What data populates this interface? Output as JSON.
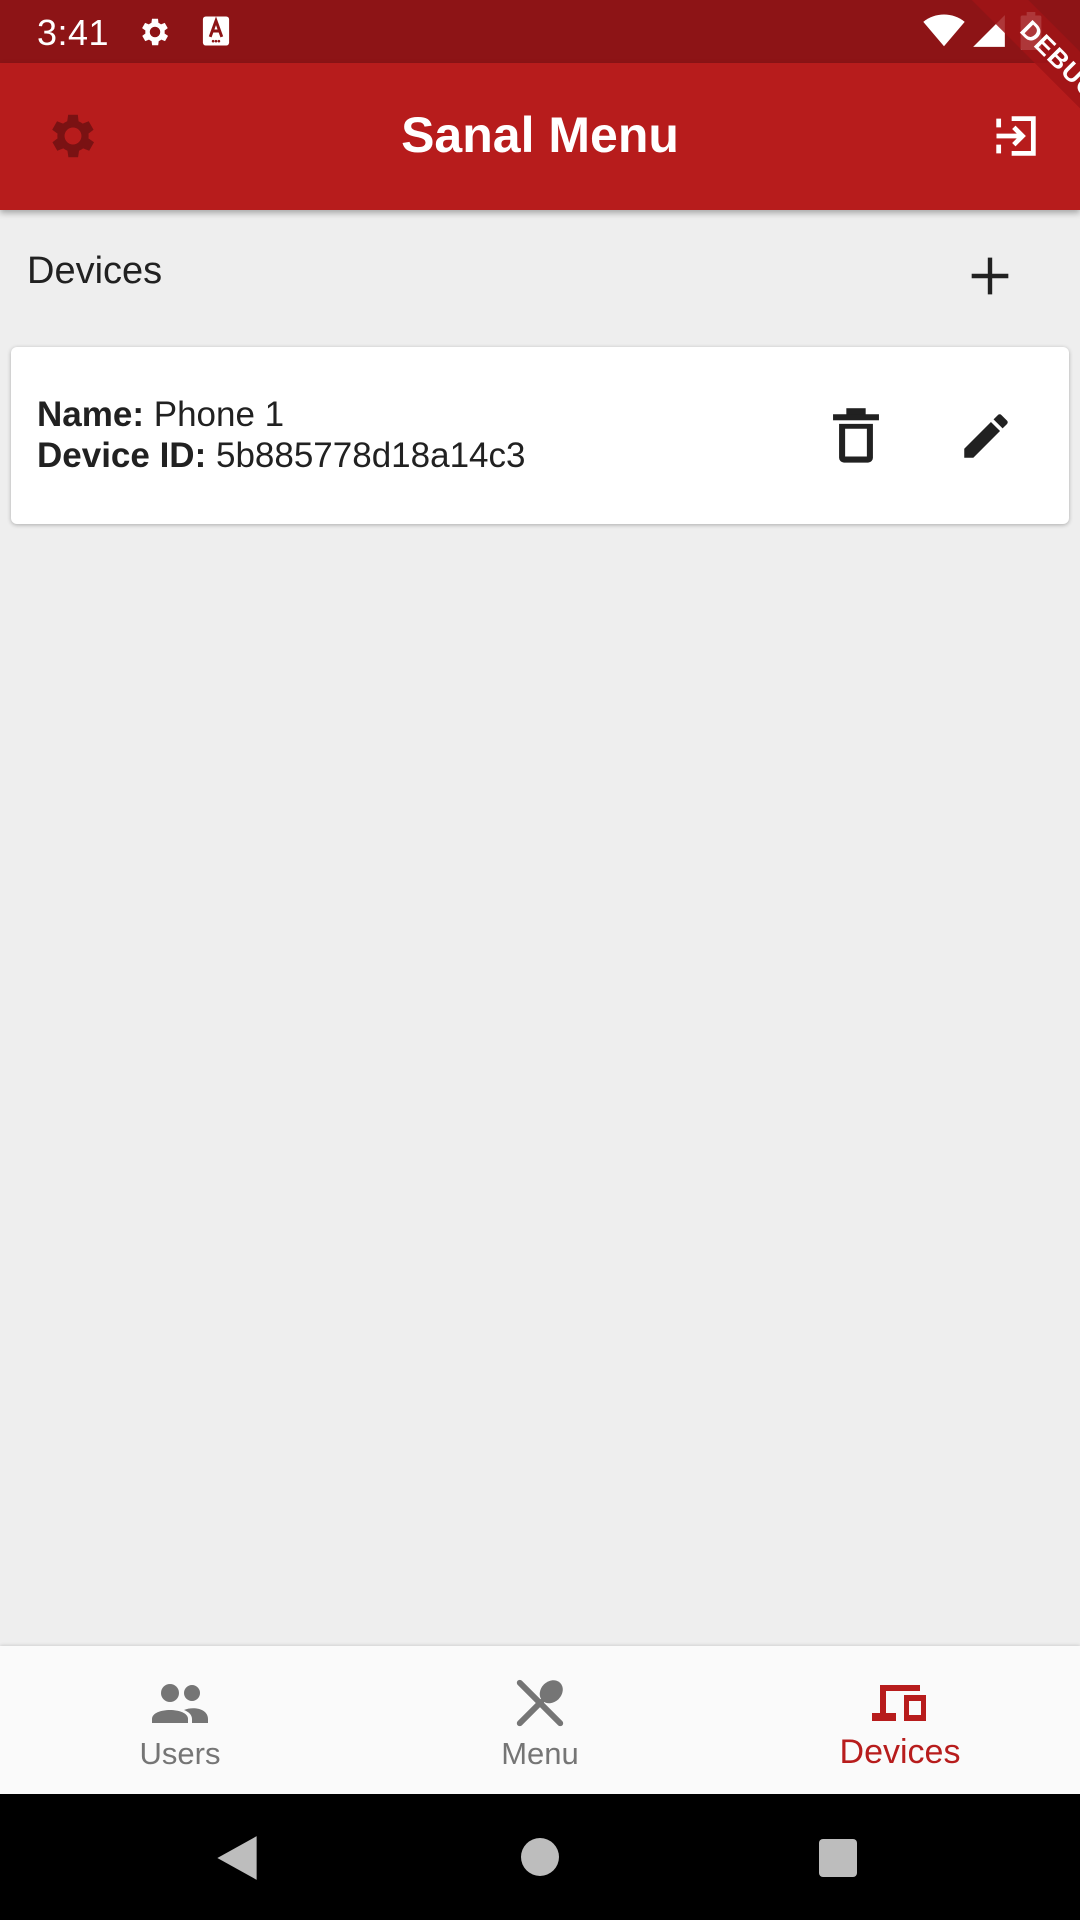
{
  "status_bar": {
    "time": "3:41",
    "icons": [
      "gear-icon",
      "a-icon",
      "wifi-icon",
      "signal-icon",
      "battery-icon"
    ]
  },
  "debug_banner": "DEBUG",
  "app_bar": {
    "title": "Sanal Menu",
    "left_icon": "gear-icon",
    "right_icon": "logout-icon"
  },
  "devices_section": {
    "title": "Devices",
    "add_icon": "plus-icon"
  },
  "devices": [
    {
      "name_label": "Name:",
      "name": "Phone 1",
      "id_label": "Device ID:",
      "device_id": "5b885778d18a14c3"
    }
  ],
  "bottom_nav": {
    "items": [
      {
        "label": "Users",
        "icon": "people-icon",
        "active": false
      },
      {
        "label": "Menu",
        "icon": "utensils-icon",
        "active": false
      },
      {
        "label": "Devices",
        "icon": "devices-icon",
        "active": true
      }
    ]
  },
  "colors": {
    "status_bar": "#8d1416",
    "app_bar": "#b71c1c",
    "accent": "#b71c1c",
    "background": "#eeeeee",
    "nav_inactive": "#757575"
  }
}
